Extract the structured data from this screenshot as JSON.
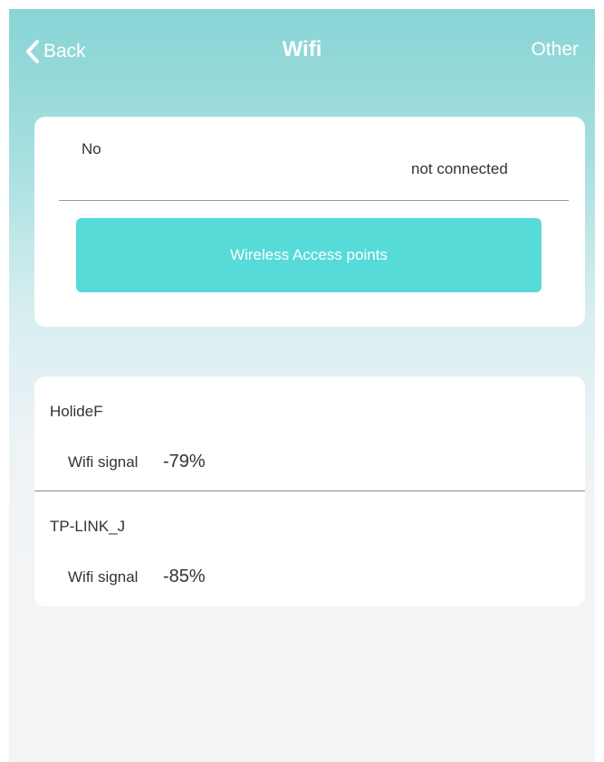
{
  "nav": {
    "back_label": "Back",
    "title": "Wifi",
    "other_label": "Other"
  },
  "status": {
    "label": "No",
    "value": "not connected",
    "button_label": "Wireless Access points"
  },
  "access_points": [
    {
      "name": "HolideF",
      "signal_label": "Wifi signal",
      "signal_value": "-79%"
    },
    {
      "name": "TP-LINK_J",
      "signal_label": "Wifi signal",
      "signal_value": "-85%"
    }
  ],
  "colors": {
    "accent_button": "#56dbd9",
    "header_gradient_top": "#88d4d5",
    "text": "#333333"
  },
  "icons": {
    "back": "chevron-left-icon"
  }
}
